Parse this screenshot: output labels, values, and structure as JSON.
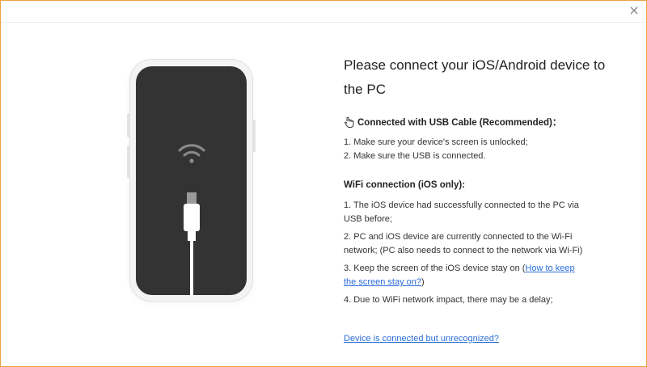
{
  "window": {
    "close_icon": "close-icon",
    "close_glyph": "×"
  },
  "illustration": {
    "phone_color": "#f4f4f4",
    "screen_color": "#333333",
    "icons": [
      "wifi-icon",
      "usb-plug-icon"
    ]
  },
  "main": {
    "title": "Please connect your iOS/Android device to the PC",
    "usb_section": {
      "icon": "hand-icon",
      "heading": "Connected with USB Cable (Recommended)：",
      "items": [
        "1. Make sure your device's screen is unlocked;",
        "2. Make sure the USB is connected."
      ]
    },
    "wifi_section": {
      "heading": "WiFi connection (iOS only):",
      "items": [
        "1. The iOS device had successfully connected to the PC via USB before;",
        "2. PC and iOS device are currently connected to the Wi-Fi network; (PC also needs to connect to the network via Wi-Fi)"
      ],
      "item3_text": "3. Keep the screen of the iOS device stay on ",
      "item3_open_paren": "(",
      "item3_link": "How to keep the screen stay on?",
      "item3_close_paren": ")",
      "item4": "4. Due to WiFi network impact, there may be a delay;"
    },
    "bottom_link": "Device is connected but unrecognized?"
  },
  "colors": {
    "link": "#2a6dd8",
    "border_accent": "#f0a040"
  }
}
